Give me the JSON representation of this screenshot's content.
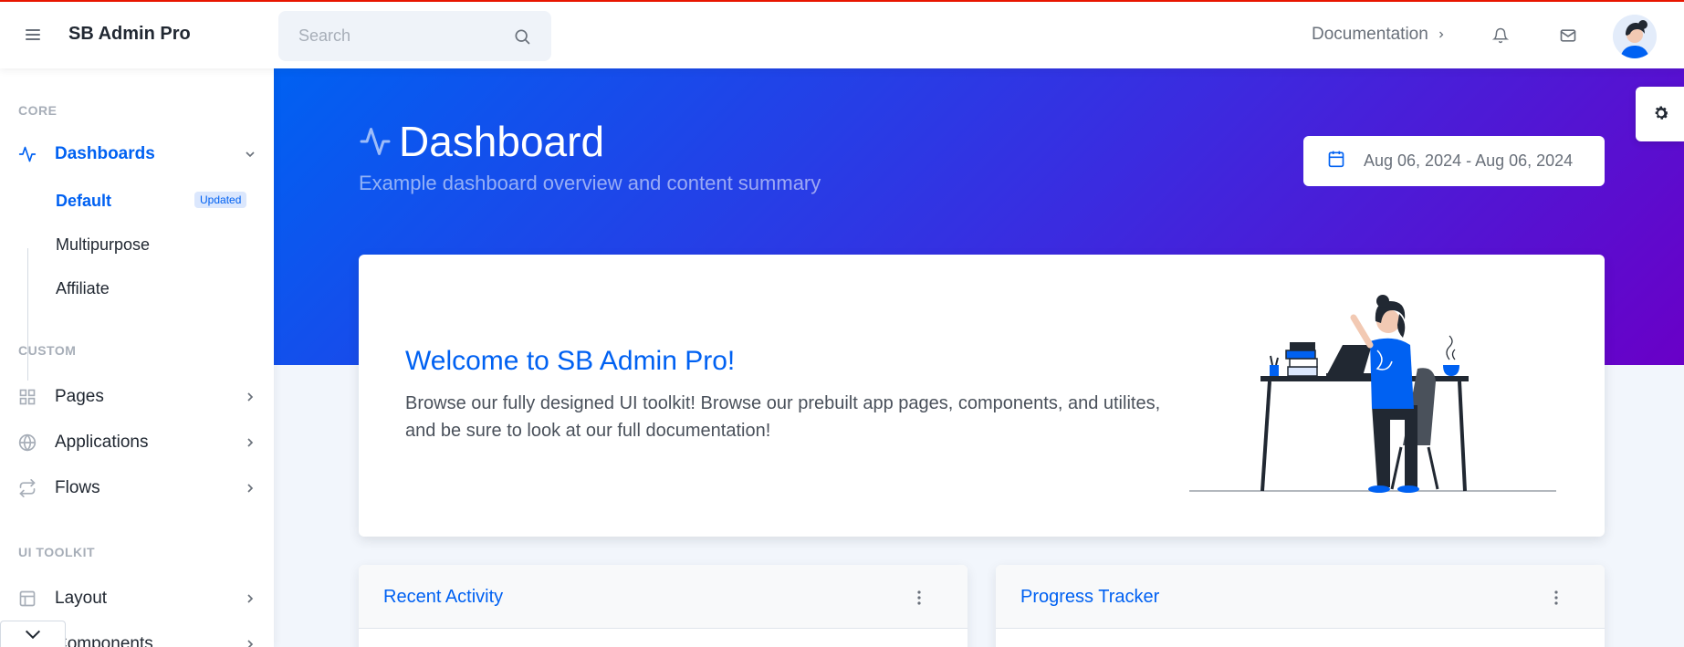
{
  "topnav": {
    "brand": "SB Admin Pro",
    "search_placeholder": "Search",
    "documentation_label": "Documentation"
  },
  "sidebar": {
    "sections": [
      {
        "heading": "CORE"
      },
      {
        "heading": "CUSTOM"
      },
      {
        "heading": "UI TOOLKIT"
      }
    ],
    "items": [
      {
        "label": "Dashboards",
        "icon": "activity-icon"
      },
      {
        "label": "Pages",
        "icon": "grid-icon"
      },
      {
        "label": "Applications",
        "icon": "globe-icon"
      },
      {
        "label": "Flows",
        "icon": "repeat-icon"
      },
      {
        "label": "Layout",
        "icon": "layout-icon"
      },
      {
        "label": "Components",
        "icon": "package-icon"
      }
    ],
    "dashboard_sub": [
      {
        "label": "Default",
        "badge": "Updated"
      },
      {
        "label": "Multipurpose"
      },
      {
        "label": "Affiliate"
      }
    ]
  },
  "header": {
    "title": "Dashboard",
    "subtitle": "Example dashboard overview and content summary",
    "daterange": "Aug 06, 2024 - Aug 06, 2024"
  },
  "welcome": {
    "title": "Welcome to SB Admin Pro!",
    "body": "Browse our fully designed UI toolkit! Browse our prebuilt app pages, components, and utilites, and be sure to look at our full documentation!"
  },
  "cards": [
    {
      "title": "Recent Activity"
    },
    {
      "title": "Progress Tracker"
    }
  ],
  "colors": {
    "primary": "#0061f2",
    "gradient_end": "#6900c7",
    "top_accent": "#e81500"
  }
}
